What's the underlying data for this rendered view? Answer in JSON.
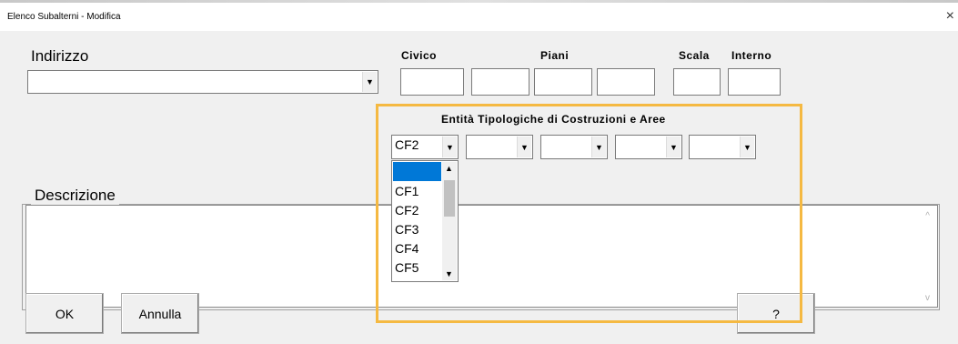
{
  "window": {
    "title": "Elenco Subalterni - Modifica",
    "close_glyph": "×"
  },
  "labels": {
    "indirizzo": "Indirizzo",
    "civico": "Civico",
    "piani": "Piani",
    "scala": "Scala",
    "interno": "Interno",
    "entita": "Entità Tipologiche di Costruzioni e Aree",
    "descrizione": "Descrizione"
  },
  "fields": {
    "indirizzo": "",
    "civico": "",
    "piani": [
      "",
      "",
      ""
    ],
    "scala": "",
    "interno": ""
  },
  "entita_combos": [
    "CF2",
    "",
    "",
    "",
    ""
  ],
  "dropdown": {
    "items": [
      "",
      "CF1",
      "CF2",
      "CF3",
      "CF4",
      "CF5"
    ],
    "selected_index": 0
  },
  "descrizione_text": "",
  "buttons": {
    "ok": "OK",
    "annulla": "Annulla",
    "help": "?"
  },
  "colors": {
    "highlight": "#f5b942",
    "selection": "#0078d7"
  }
}
